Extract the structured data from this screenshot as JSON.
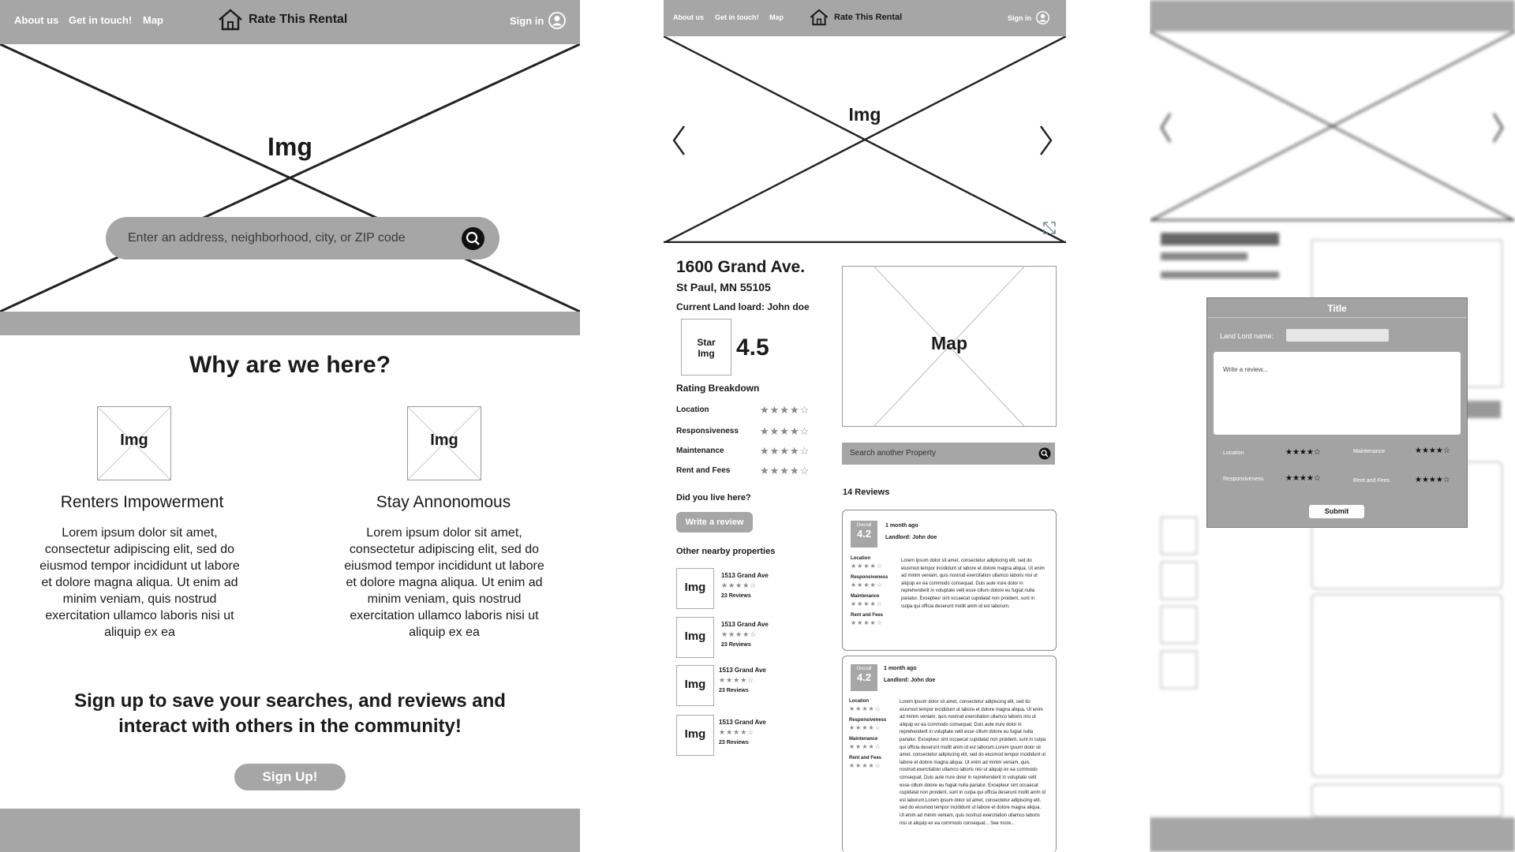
{
  "nav": {
    "about": "About us",
    "contact": "Get in touch!",
    "map": "Map",
    "brand": "Rate This Rental",
    "signin": "Sign in"
  },
  "home": {
    "hero_img": "Img",
    "search_placeholder": "Enter an address, neighborhood, city, or ZIP code",
    "why_title": "Why are we here?",
    "features": [
      {
        "img": "Img",
        "title": "Renters Impowerment",
        "text": "Lorem ipsum dolor sit amet, consectetur adipiscing elit, sed do eiusmod tempor incididunt ut labore et dolore magna aliqua. Ut enim ad minim veniam, quis nostrud exercitation ullamco laboris nisi ut aliquip ex ea"
      },
      {
        "img": "Img",
        "title": "Stay Annonomous",
        "text": "Lorem ipsum dolor sit amet, consectetur adipiscing elit, sed do eiusmod tempor incididunt ut labore et dolore magna aliqua. Ut enim ad minim veniam, quis nostrud exercitation ullamco laboris nisi ut aliquip ex ea"
      }
    ],
    "signup_text": "Sign up to save your searches, and reviews and interact with others in the community!",
    "signup_button": "Sign Up!"
  },
  "property": {
    "hero_img": "Img",
    "address": "1600 Grand Ave.",
    "city": "St Paul, MN 55105",
    "landlord": "Current Land loard: John doe",
    "star_img": "Star Img",
    "rating": "4.5",
    "breakdown_title": "Rating Breakdown",
    "breakdown": [
      {
        "label": "Location",
        "stars": "★★★★☆"
      },
      {
        "label": "Responsiveness",
        "stars": "★★★★☆"
      },
      {
        "label": "Maintenance",
        "stars": "★★★★☆"
      },
      {
        "label": "Rent and Fees",
        "stars": "★★★★☆"
      }
    ],
    "lived_here": "Did you live here?",
    "write_review": "Write a review",
    "nearby_title": "Other nearby properties",
    "nearby": [
      {
        "img": "Img",
        "name": "1513 Grand Ave",
        "stars": "★★★★☆",
        "reviews": "23 Reviews"
      },
      {
        "img": "Img",
        "name": "1513 Grand Ave",
        "stars": "★★★★☆",
        "reviews": "23 Reviews"
      },
      {
        "img": "Img",
        "name": "1513 Grand Ave",
        "stars": "★★★★☆",
        "reviews": "23 Reviews"
      },
      {
        "img": "Img",
        "name": "1513 Grand Ave",
        "stars": "★★★★☆",
        "reviews": "23 Reviews"
      }
    ],
    "map": "Map",
    "search_placeholder": "Search another Property",
    "reviews_count": "14 Reviews",
    "reviews": [
      {
        "overall": "Overall",
        "score": "4.2",
        "time": "1 month ago",
        "landlord": "Landlord: John doe",
        "cats": [
          {
            "label": "Location",
            "stars": "★★★★☆"
          },
          {
            "label": "Responsiveness",
            "stars": "★★★★☆"
          },
          {
            "label": "Maintenance",
            "stars": "★★★★☆"
          },
          {
            "label": "Rent and Fees",
            "stars": "★★★★☆"
          }
        ],
        "text": "Lorem ipsum dolor sit amet, consectetur adipiscing elit, sed do eiusmod tempor incididunt ut labore et dolore magna aliqua. Ut enim ad minim veniam, quis nostrud exercitation ullamco laboris nisi ut aliquip ex ea commodo consequat. Duis aute irure dolor in reprehenderit in voluptate velit esse cillum dolore eu fugiat nulla pariatur. Excepteur sint occaecat cupidatat non proident, sunt in culpa qui officia deserunt mollit anim id est laborum."
      },
      {
        "overall": "Overall",
        "score": "4.2",
        "time": "1 month ago",
        "landlord": "Landlord: John doe",
        "cats": [
          {
            "label": "Location",
            "stars": "★★★★☆"
          },
          {
            "label": "Responsiveness",
            "stars": "★★★★☆"
          },
          {
            "label": "Maintenance",
            "stars": "★★★★☆"
          },
          {
            "label": "Rent and Fees",
            "stars": "★★★★☆"
          }
        ],
        "text": "Lorem ipsum dolor sit amet, consectetur adipiscing elit, sed do eiusmod tempor incididunt ut labore et dolore magna aliqua. Ut enim ad minim veniam, quis nostrud exercitation ullamco laboris nisi ut aliquip ex ea commodo consequat. Duis aute irure dolor in reprehenderit in voluptate velit esse cillum dolore eu fugiat nulla pariatur. Excepteur sint occaecat cupidatat non proident, sunt in culpa qui officia deserunt mollit anim id est laborum.Lorem ipsum dolor sit amet, consectetur adipiscing elit, sed do eiusmod tempor incididunt ut labore et dolore magna aliqua. Ut enim ad minim veniam, quis nostrud exercitation ullamco laboris nisi ut aliquip ex ea commodo consequat. Duis aute irure dolor in reprehenderit in voluptate velit esse cillum dolore eu fugiat nulla pariatur. Excepteur sint occaecat cupidatat non proident, sunt in culpa qui officia deserunt mollit anim id est laborum.Lorem ipsum dolor sit amet, consectetur adipiscing elit, sed do eiusmod tempor incididunt ut labore et dolore magna aliqua. Ut enim ad minim veniam, quis nostrud exercitation ullamco laboris nisi ut aliquip ex ea commodo consequat... See more..."
      }
    ]
  },
  "modal": {
    "title": "Title",
    "landlord_label": "Land Lord name:",
    "review_placeholder": "Write a review...",
    "cats": [
      {
        "label": "Location",
        "stars": "★★★★☆"
      },
      {
        "label": "Maintenance",
        "stars": "★★★★☆"
      },
      {
        "label": "Responsiveness",
        "stars": "★★★★☆"
      },
      {
        "label": "Rent and Fees",
        "stars": "★★★★☆"
      }
    ],
    "submit": "Submit"
  },
  "colors": {
    "nav_grey": "#a6a6a6",
    "dark": "#1a1a1a",
    "modal_grey": "#a3a3a3"
  }
}
